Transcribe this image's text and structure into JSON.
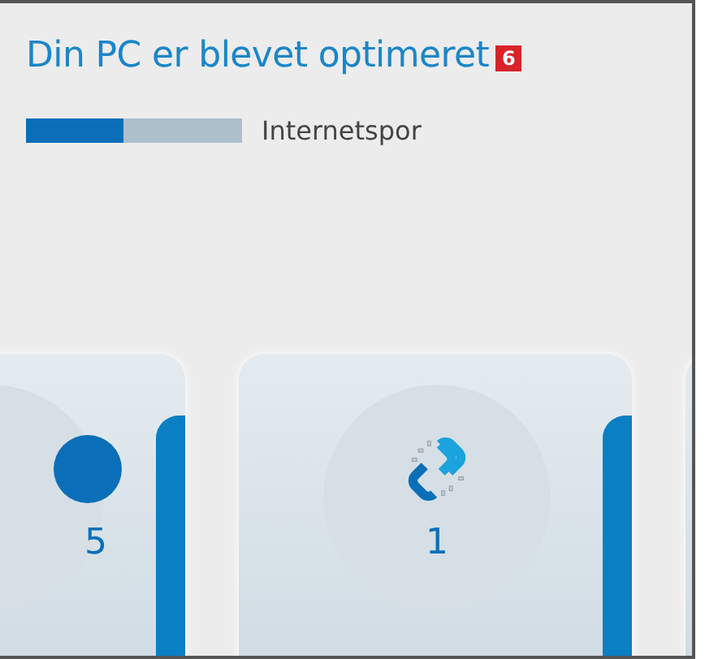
{
  "title": "Din PC er blevet optimeret",
  "badge": "6",
  "progress": {
    "level": 0.45,
    "label": "Internetspor"
  },
  "cards": [
    {
      "kind": "disc",
      "value": "5"
    },
    {
      "kind": "broken-link",
      "value": "1"
    },
    {
      "kind": "blank"
    }
  ]
}
